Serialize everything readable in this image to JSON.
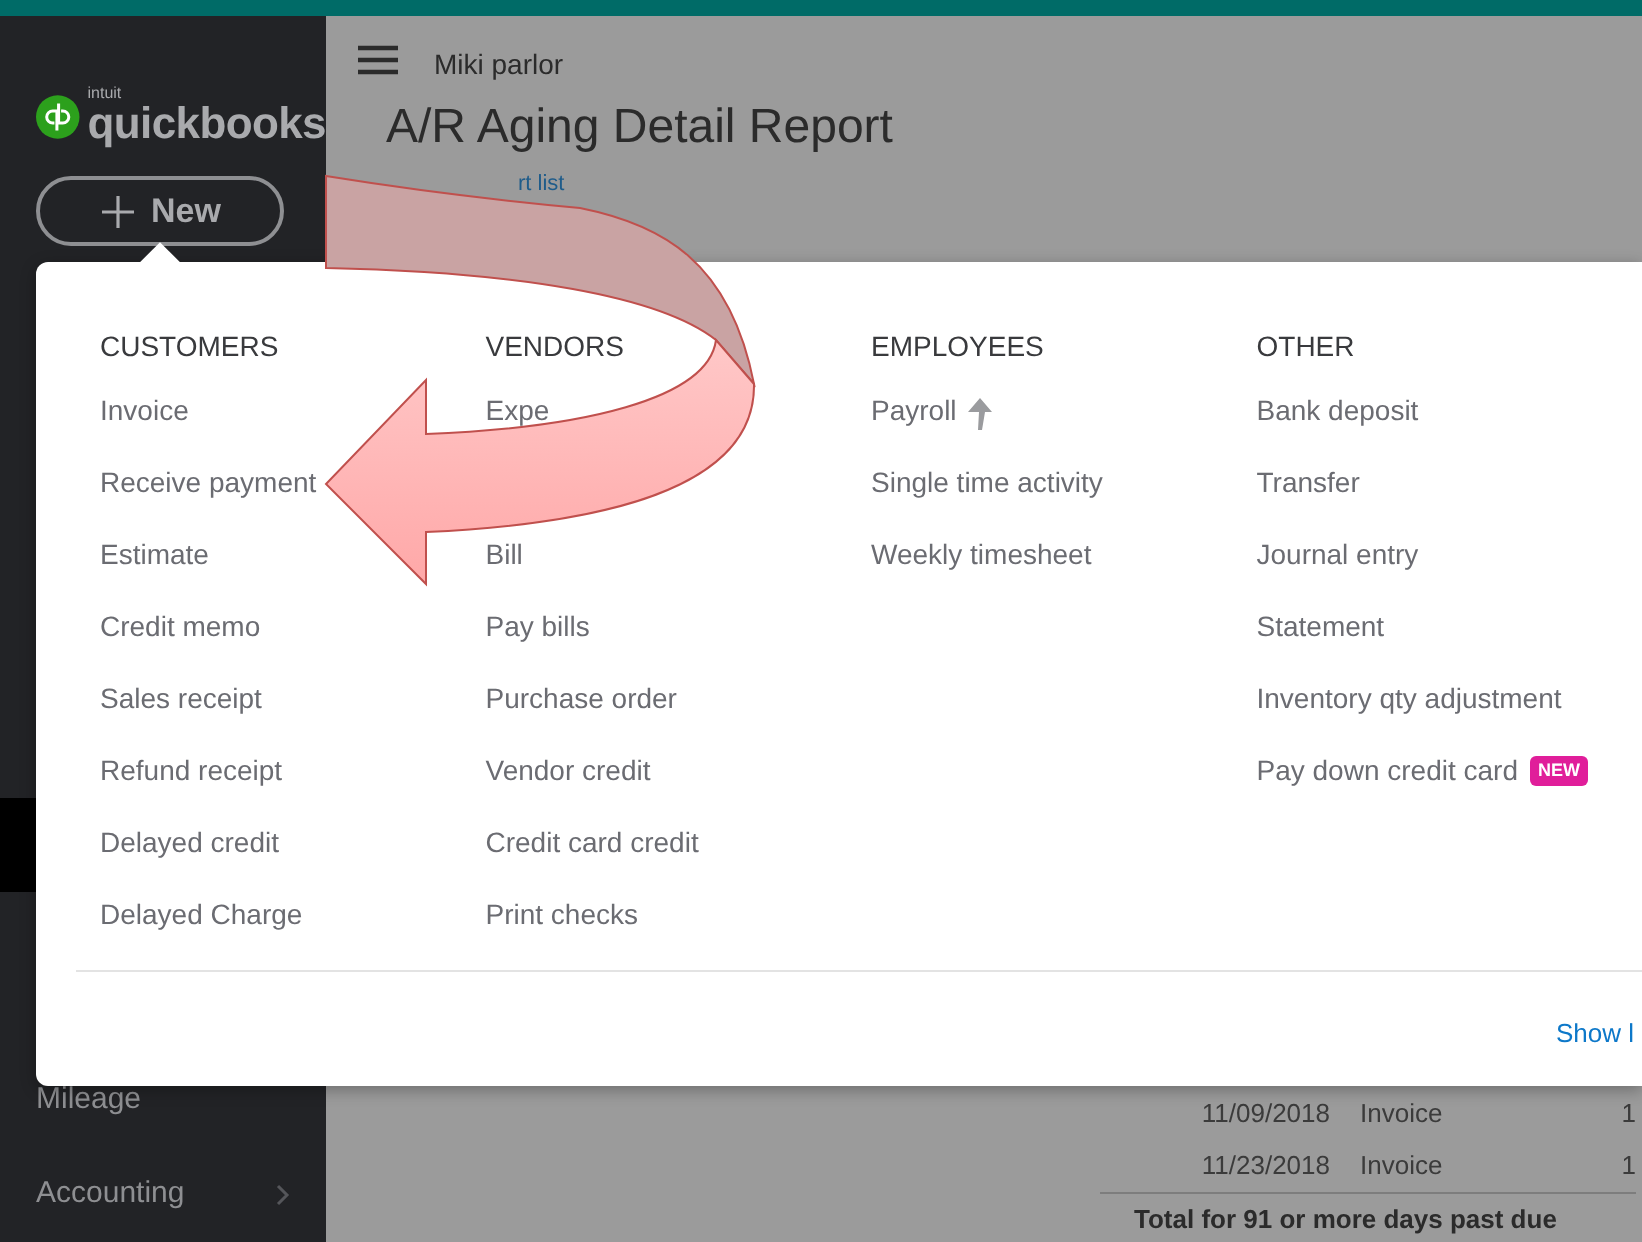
{
  "top_bar": {
    "color": "#006b67"
  },
  "sidebar": {
    "logo": {
      "brand": "intuit",
      "name": "quickbooks"
    },
    "new_button": {
      "label": "New"
    },
    "items": [
      {
        "selected": true
      },
      {
        "label": "Mileage",
        "selected": false
      },
      {
        "label": "Accounting",
        "selected": false,
        "chevron": true
      }
    ]
  },
  "header": {
    "company": "Miki parlor"
  },
  "report": {
    "title": "A/R Aging Detail Report",
    "back_link": "rt list",
    "rows": [
      {
        "date": "11/09/2018",
        "type": "Invoice",
        "column_3": "1"
      },
      {
        "date": "11/23/2018",
        "type": "Invoice",
        "column_3": "1"
      }
    ],
    "total_label": "Total for 91 or more days past due"
  },
  "new_menu": {
    "columns": [
      {
        "heading": "CUSTOMERS",
        "items": [
          {
            "kind": "link",
            "label": "Invoice"
          },
          {
            "kind": "link",
            "label": "Receive payment"
          },
          {
            "kind": "link",
            "label": "Estimate"
          },
          {
            "kind": "link",
            "label": "Credit memo"
          },
          {
            "kind": "link",
            "label": "Sales receipt"
          },
          {
            "kind": "link",
            "label": "Refund receipt"
          },
          {
            "kind": "link",
            "label": "Delayed credit"
          },
          {
            "kind": "link",
            "label": "Delayed Charge"
          }
        ]
      },
      {
        "heading": "VENDORS",
        "items": [
          {
            "kind": "link",
            "label": "Expe"
          },
          {
            "kind": "covered"
          },
          {
            "kind": "link",
            "label": "Bill"
          },
          {
            "kind": "link",
            "label": "Pay bills"
          },
          {
            "kind": "link",
            "label": "Purchase order"
          },
          {
            "kind": "link",
            "label": "Vendor credit"
          },
          {
            "kind": "link",
            "label": "Credit card credit"
          },
          {
            "kind": "link",
            "label": "Print checks"
          }
        ]
      },
      {
        "heading": "EMPLOYEES",
        "items": [
          {
            "kind": "upgrade",
            "label": "Payroll"
          },
          {
            "kind": "link",
            "label": "Single time activity"
          },
          {
            "kind": "link",
            "label": "Weekly timesheet"
          }
        ]
      },
      {
        "heading": "OTHER",
        "items": [
          {
            "kind": "link",
            "label": "Bank deposit"
          },
          {
            "kind": "link",
            "label": "Transfer"
          },
          {
            "kind": "link",
            "label": "Journal entry"
          },
          {
            "kind": "link",
            "label": "Statement"
          },
          {
            "kind": "link",
            "label": "Inventory qty adjustment"
          },
          {
            "kind": "badge",
            "label": "Pay down credit card",
            "badge": "NEW"
          }
        ]
      }
    ],
    "footer_link": "Show l"
  }
}
